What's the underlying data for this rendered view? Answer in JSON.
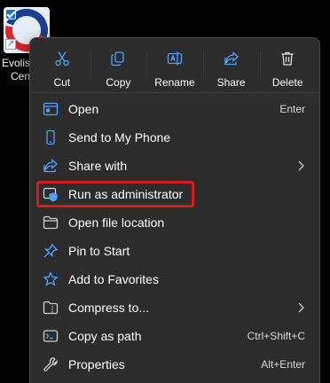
{
  "desktop_icon": {
    "label_line1": "Evolis",
    "label_line2": "Cen",
    "shortcut_glyph": "↗"
  },
  "toolbar": [
    {
      "label": "Cut",
      "icon": "scissors-icon"
    },
    {
      "label": "Copy",
      "icon": "copy-icon"
    },
    {
      "label": "Rename",
      "icon": "rename-icon"
    },
    {
      "label": "Share",
      "icon": "share-icon"
    },
    {
      "label": "Delete",
      "icon": "trash-icon"
    }
  ],
  "items": [
    {
      "label": "Open",
      "shortcut": "Enter",
      "icon": "open-icon"
    },
    {
      "label": "Send to My Phone",
      "shortcut": "",
      "icon": "phone-icon"
    },
    {
      "label": "Share with",
      "shortcut": "",
      "icon": "share-with-icon",
      "submenu": true
    },
    {
      "label": "Run as administrator",
      "shortcut": "",
      "icon": "shield-icon",
      "highlighted": true
    },
    {
      "label": "Open file location",
      "shortcut": "",
      "icon": "folder-icon"
    },
    {
      "label": "Pin to Start",
      "shortcut": "",
      "icon": "pin-icon"
    },
    {
      "label": "Add to Favorites",
      "shortcut": "",
      "icon": "star-icon"
    },
    {
      "label": "Compress to...",
      "shortcut": "",
      "icon": "zip-folder-icon",
      "submenu": true
    },
    {
      "label": "Copy as path",
      "shortcut": "Ctrl+Shift+C",
      "icon": "path-icon"
    },
    {
      "label": "Properties",
      "shortcut": "Alt+Enter",
      "icon": "wrench-icon"
    }
  ],
  "colors": {
    "menu_bg": "#2c2c2c",
    "accent_blue": "#4fa3ff",
    "highlight_border": "#d41d1d"
  }
}
